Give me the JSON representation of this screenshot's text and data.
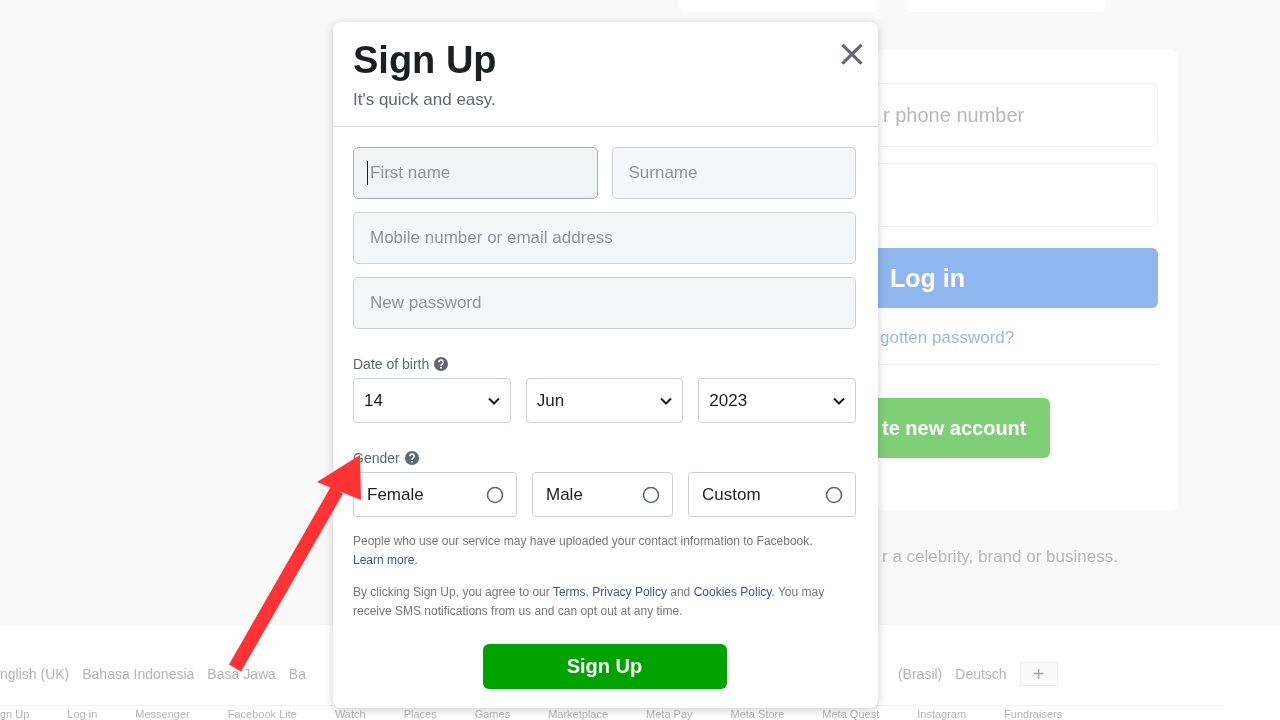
{
  "background": {
    "login_card": {
      "email_placeholder": "r phone number",
      "login_button": "Log in",
      "forgot_link": "gotten password?",
      "create_button": "te new account"
    },
    "page_note": "r a celebrity, brand or business.",
    "languages_left": [
      "nglish (UK)",
      "Bahasa Indonesia",
      "Basa Jawa",
      "Ba"
    ],
    "languages_right": [
      "(Brasil)",
      "Deutsch"
    ],
    "add_language": "+",
    "footer_links": [
      "gn Up",
      "Log in",
      "Messenger",
      "Facebook Lite",
      "Watch",
      "Places",
      "Games",
      "Marketplace",
      "Meta Pay",
      "Meta Store",
      "Meta Quest",
      "Instagram",
      "Fundraisers"
    ]
  },
  "modal": {
    "title": "Sign Up",
    "subtitle": "It's quick and easy.",
    "close": "×",
    "name_fields": [
      {
        "placeholder": "First name",
        "focused": true
      },
      {
        "placeholder": "Surname",
        "focused": false
      }
    ],
    "fields": [
      {
        "placeholder": "Mobile number or email address",
        "focused": false
      },
      {
        "placeholder": "New password",
        "focused": false
      }
    ],
    "date_of_birth": {
      "label": "Date of birth",
      "selects": [
        {
          "value": "14"
        },
        {
          "value": "Jun"
        },
        {
          "value": "2023"
        }
      ]
    },
    "gender": {
      "label": "Gender",
      "options": [
        {
          "label": "Female",
          "selected": false
        },
        {
          "label": "Male",
          "selected": false
        },
        {
          "label": "Custom",
          "selected": false
        }
      ]
    },
    "notices": [
      [
        {
          "text": "People who use our service may have uploaded your contact information to Facebook. "
        },
        {
          "text": "Learn more",
          "kind": "link"
        },
        {
          "text": "."
        }
      ],
      [
        {
          "text": "By clicking Sign Up, you agree to our "
        },
        {
          "text": "Terms",
          "kind": "link"
        },
        {
          "text": ", "
        },
        {
          "text": "Privacy Policy",
          "kind": "link"
        },
        {
          "text": " and "
        },
        {
          "text": "Cookies Policy",
          "kind": "link"
        },
        {
          "text": ". You may receive SMS notifications from us and can opt out at any time."
        }
      ]
    ],
    "submit": "Sign Up"
  }
}
